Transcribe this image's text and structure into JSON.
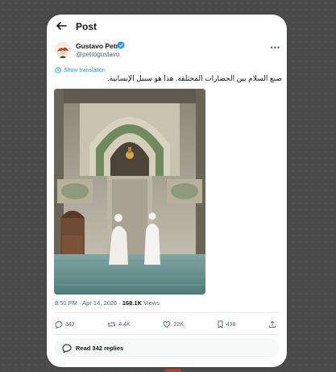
{
  "header": {
    "title": "Post"
  },
  "author": {
    "name": "Gustavo Petro",
    "handle": "@petrogustavo"
  },
  "translate_label": "Show translation",
  "tweet_text": "صنع السلام بين الحضارات المختلفة. هذا هو سبيل الإنسانية.",
  "meta": {
    "time": "8:50 PM · Apr 14, 2026 · ",
    "views_count": "168.1K",
    "views_label": " Views"
  },
  "actions": {
    "replies": "342",
    "reposts": "4.4K",
    "likes": "22K",
    "bookmarks": "438"
  },
  "read_replies_label": "Read 342 replies",
  "colors": {
    "accent": "#1d9bf0",
    "muted": "#536471",
    "text": "#0f1419"
  }
}
